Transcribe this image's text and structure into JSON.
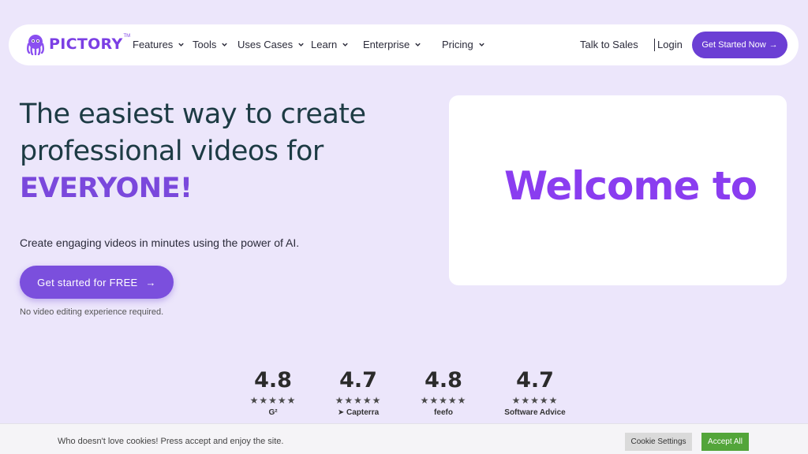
{
  "brand": {
    "name": "PICTORY",
    "tm": "TM",
    "color": "#7b3fe4"
  },
  "nav": {
    "items": [
      {
        "label": "Features"
      },
      {
        "label": "Tools"
      },
      {
        "label": "Uses Cases"
      },
      {
        "label": "Learn"
      },
      {
        "label": "Enterprise"
      },
      {
        "label": "Pricing"
      }
    ],
    "talk_to_sales": "Talk to Sales",
    "login": "Login",
    "cta": "Get Started Now"
  },
  "hero": {
    "title_line1": "The easiest way to create",
    "title_line2": "professional videos for",
    "title_accent": "EVERYONE!",
    "subtitle": "Create engaging videos in minutes using the power of AI.",
    "button": "Get started for FREE",
    "note": "No video editing experience required."
  },
  "video": {
    "text": "Welcome to"
  },
  "ratings": [
    {
      "score": "4.8",
      "stars": "★★★★★",
      "brand": "G²"
    },
    {
      "score": "4.7",
      "stars": "★★★★★",
      "brand": "Capterra"
    },
    {
      "score": "4.8",
      "stars": "★★★★★",
      "brand": "feefo"
    },
    {
      "score": "4.7",
      "stars": "★★★★★",
      "brand": "Software Advice"
    }
  ],
  "cookie": {
    "text": "Who doesn't love cookies! Press accept and enjoy the site.",
    "settings": "Cookie Settings",
    "accept": "Accept All"
  },
  "colors": {
    "background": "#ece6fb",
    "primary": "#6b3fd4",
    "accent": "#7a48dc",
    "accept": "#53a53a"
  }
}
